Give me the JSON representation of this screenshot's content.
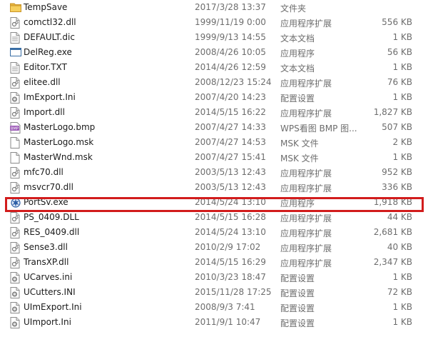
{
  "files": [
    {
      "name": "TempSave",
      "date": "2017/3/28 13:37",
      "type": "文件夹",
      "size": "",
      "icon": "folder-icon",
      "highlighted": false
    },
    {
      "name": "comctl32.dll",
      "date": "1999/11/19 0:00",
      "type": "应用程序扩展",
      "size": "556 KB",
      "icon": "dll-icon",
      "highlighted": false
    },
    {
      "name": "DEFAULT.dic",
      "date": "1999/9/13 14:55",
      "type": "文本文档",
      "size": "1 KB",
      "icon": "text-file-icon",
      "highlighted": false
    },
    {
      "name": "DelReg.exe",
      "date": "2008/4/26 10:05",
      "type": "应用程序",
      "size": "56 KB",
      "icon": "exe-window-icon",
      "highlighted": false
    },
    {
      "name": "Editor.TXT",
      "date": "2014/4/26 12:59",
      "type": "文本文档",
      "size": "1 KB",
      "icon": "text-file-icon",
      "highlighted": false
    },
    {
      "name": "elitee.dll",
      "date": "2008/12/23 15:24",
      "type": "应用程序扩展",
      "size": "76 KB",
      "icon": "dll-icon",
      "highlighted": false
    },
    {
      "name": "ImExport.Ini",
      "date": "2007/4/20 14:23",
      "type": "配置设置",
      "size": "1 KB",
      "icon": "ini-icon",
      "highlighted": false
    },
    {
      "name": "Import.dll",
      "date": "2014/5/15 16:22",
      "type": "应用程序扩展",
      "size": "1,827 KB",
      "icon": "dll-icon",
      "highlighted": false
    },
    {
      "name": "MasterLogo.bmp",
      "date": "2007/4/27 14:33",
      "type": "WPS看图 BMP 图...",
      "size": "507 KB",
      "icon": "bmp-icon",
      "highlighted": false
    },
    {
      "name": "MasterLogo.msk",
      "date": "2007/4/27 14:53",
      "type": "MSK 文件",
      "size": "2 KB",
      "icon": "blank-file-icon",
      "highlighted": false
    },
    {
      "name": "MasterWnd.msk",
      "date": "2007/4/27 15:41",
      "type": "MSK 文件",
      "size": "1 KB",
      "icon": "blank-file-icon",
      "highlighted": false
    },
    {
      "name": "mfc70.dll",
      "date": "2003/5/13 12:43",
      "type": "应用程序扩展",
      "size": "952 KB",
      "icon": "dll-icon",
      "highlighted": false
    },
    {
      "name": "msvcr70.dll",
      "date": "2003/5/13 12:43",
      "type": "应用程序扩展",
      "size": "336 KB",
      "icon": "dll-icon",
      "highlighted": false
    },
    {
      "name": "PortSv.exe",
      "date": "2014/5/24 13:10",
      "type": "应用程序",
      "size": "1,918 KB",
      "icon": "portsv-exe-icon",
      "highlighted": true
    },
    {
      "name": "PS_0409.DLL",
      "date": "2014/5/15 16:28",
      "type": "应用程序扩展",
      "size": "44 KB",
      "icon": "dll-icon",
      "highlighted": false
    },
    {
      "name": "RES_0409.dll",
      "date": "2014/5/24 13:10",
      "type": "应用程序扩展",
      "size": "2,681 KB",
      "icon": "dll-icon",
      "highlighted": false
    },
    {
      "name": "Sense3.dll",
      "date": "2010/2/9 17:02",
      "type": "应用程序扩展",
      "size": "40 KB",
      "icon": "dll-icon",
      "highlighted": false
    },
    {
      "name": "TransXP.dll",
      "date": "2014/5/15 16:29",
      "type": "应用程序扩展",
      "size": "2,347 KB",
      "icon": "dll-icon",
      "highlighted": false
    },
    {
      "name": "UCarves.ini",
      "date": "2010/3/23 18:47",
      "type": "配置设置",
      "size": "1 KB",
      "icon": "ini-icon",
      "highlighted": false
    },
    {
      "name": "UCutters.INI",
      "date": "2015/11/28 17:25",
      "type": "配置设置",
      "size": "72 KB",
      "icon": "ini-icon",
      "highlighted": false
    },
    {
      "name": "UImExport.Ini",
      "date": "2008/9/3 7:41",
      "type": "配置设置",
      "size": "1 KB",
      "icon": "ini-icon",
      "highlighted": false
    },
    {
      "name": "UImport.Ini",
      "date": "2011/9/1 10:47",
      "type": "配置设置",
      "size": "1 KB",
      "icon": "ini-icon",
      "highlighted": false
    }
  ],
  "colors": {
    "highlight_border": "#d21c1c",
    "folder": "#f1c54b",
    "bmp": "#9b59b6"
  }
}
